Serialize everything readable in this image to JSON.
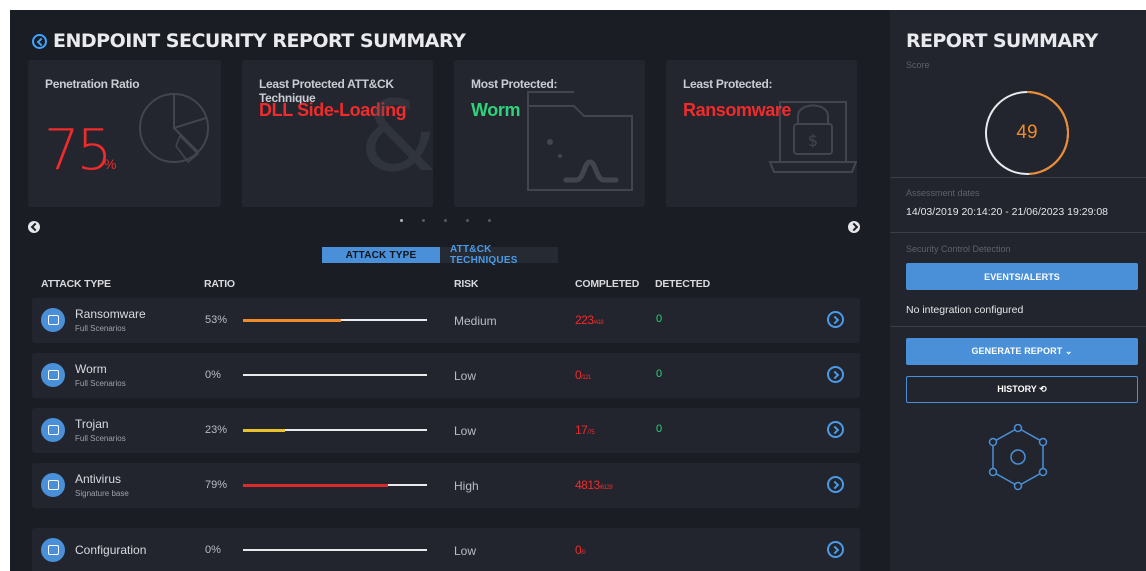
{
  "main": {
    "title": "ENDPOINT SECURITY REPORT SUMMARY",
    "cards": [
      {
        "label": "Penetration Ratio",
        "value": "75",
        "unit": "%",
        "icon": "pie-chart-icon"
      },
      {
        "label": "Least Protected ATT&CK Technique",
        "value": "DLL Side-Loading",
        "icon": "ampersand-icon"
      },
      {
        "label": "Most Protected:",
        "value": "Worm",
        "icon": "worm-icon"
      },
      {
        "label": "Least Protected:",
        "value": "Ransomware",
        "icon": "ransomware-laptop-icon"
      }
    ],
    "carousel": {
      "dot_count": 5,
      "active_index": 0
    },
    "tabs": [
      {
        "label": "ATTACK TYPE",
        "active": true
      },
      {
        "label": "ATT&CK TECHNIQUES",
        "active": false
      }
    ],
    "table": {
      "headers": {
        "attack_type": "ATTACK TYPE",
        "ratio": "RATIO",
        "risk": "RISK",
        "completed": "COMPLETED",
        "detected": "DETECTED"
      },
      "rows": [
        {
          "name": "Ransomware",
          "sub": "Full Scenarios",
          "ratio": "53%",
          "ratio_value": 0.53,
          "bar_color": "#f08a2b",
          "risk": "Medium",
          "completed": "223",
          "completed_total": "/418",
          "detected": "0"
        },
        {
          "name": "Worm",
          "sub": "Full Scenarios",
          "ratio": "0%",
          "ratio_value": 0,
          "bar_color": "#f08a2b",
          "risk": "Low",
          "completed": "0",
          "completed_total": "/121",
          "detected": "0"
        },
        {
          "name": "Trojan",
          "sub": "Full Scenarios",
          "ratio": "23%",
          "ratio_value": 0.23,
          "bar_color": "#e8c22b",
          "risk": "Low",
          "completed": "17",
          "completed_total": "/75",
          "detected": "0"
        },
        {
          "name": "Antivirus",
          "sub": "Signature base",
          "ratio": "79%",
          "ratio_value": 0.79,
          "bar_color": "#d92b2b",
          "risk": "High",
          "completed": "4813",
          "completed_total": "/6129",
          "detected": ""
        },
        {
          "name": "Configuration",
          "sub": "",
          "ratio": "0%",
          "ratio_value": 0,
          "bar_color": "#f08a2b",
          "risk": "Low",
          "completed": "0",
          "completed_total": "/0",
          "detected": ""
        }
      ]
    }
  },
  "sidebar": {
    "title": "REPORT SUMMARY",
    "score_label": "Score",
    "score": "49",
    "score_value": 0.49,
    "score_color": "#f08a2b",
    "assessment_label": "Assessment dates",
    "assessment_dates": "14/03/2019 20:14:20 - 21/06/2023 19:29:08",
    "detection_label": "Security Control Detection",
    "events_button": "EVENTS/ALERTS",
    "integration_text": "No integration configured",
    "generate_button": "GENERATE REPORT ⌄",
    "history_button": "HISTORY ⟲"
  },
  "colors": {
    "accent": "#4a90d9",
    "danger": "#ef2b2b",
    "success": "#2ed37b",
    "warning": "#f08a2b"
  }
}
